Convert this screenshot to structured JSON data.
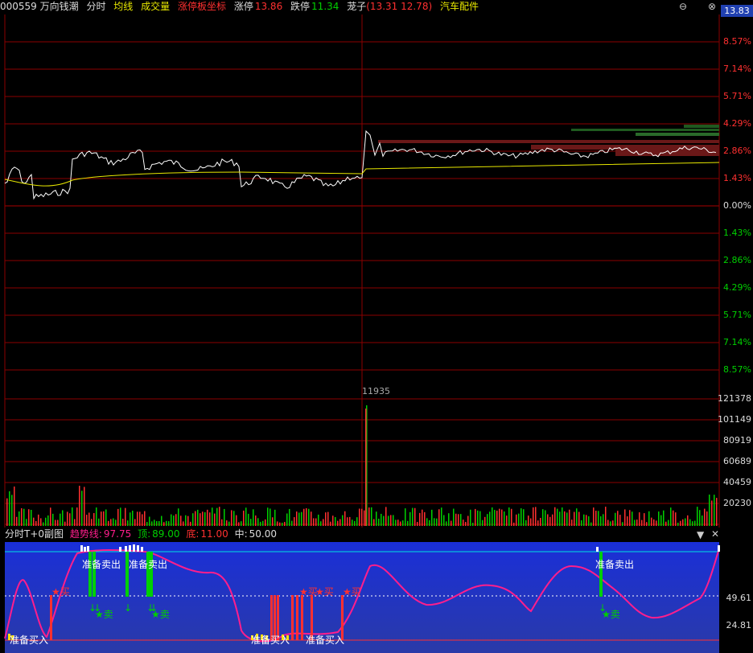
{
  "header": {
    "code_name": "000559 万向钱潮",
    "mode": "分时",
    "avg_line": "均线",
    "volume": "成交量",
    "limit_coord": "涨停板坐标",
    "limit_up_label": "涨停",
    "limit_up_value": "13.86",
    "limit_down_label": "跌停",
    "limit_down_value": "11.34",
    "stock_name": "茏子",
    "quote": "(13.31 12.78)",
    "sector": "汽车配件",
    "price_box": "13.83"
  },
  "price_axis": {
    "up_labels": [
      "8.57%",
      "7.14%",
      "5.71%",
      "4.29%",
      "2.86%",
      "1.43%"
    ],
    "zero_label": "0.00%",
    "down_labels": [
      "1.43%",
      "2.86%",
      "4.29%",
      "5.71%",
      "7.14%",
      "8.57%"
    ]
  },
  "volume_panel": {
    "peak_label": "11935",
    "labels": [
      "121378",
      "101149",
      "80919",
      "60689",
      "40459",
      "20230"
    ]
  },
  "sub_panel": {
    "title": "分时T+0副图",
    "trend_label": "趋势线:",
    "trend_value": "97.75",
    "top_label": "顶:",
    "top_value": "89.00",
    "bottom_label": "底:",
    "bottom_value": "11.00",
    "mid_label": "中:",
    "mid_value": "50.00",
    "axis_labels": [
      "49.61",
      "24.81"
    ],
    "annotations": {
      "prepare_sell": "准备卖出",
      "prepare_buy": "准备买入",
      "buy": "★买",
      "sell": "★卖"
    }
  },
  "colors": {
    "grid_red": "#8b0000",
    "up_red": "#ff3030",
    "down_green": "#00d000",
    "price_white": "#ffffff",
    "avg_yellow": "#e8e800",
    "sub_bg": "#1c2fd0",
    "trend_magenta": "#ff1e8c",
    "cyan_line": "#00e0e0"
  }
}
